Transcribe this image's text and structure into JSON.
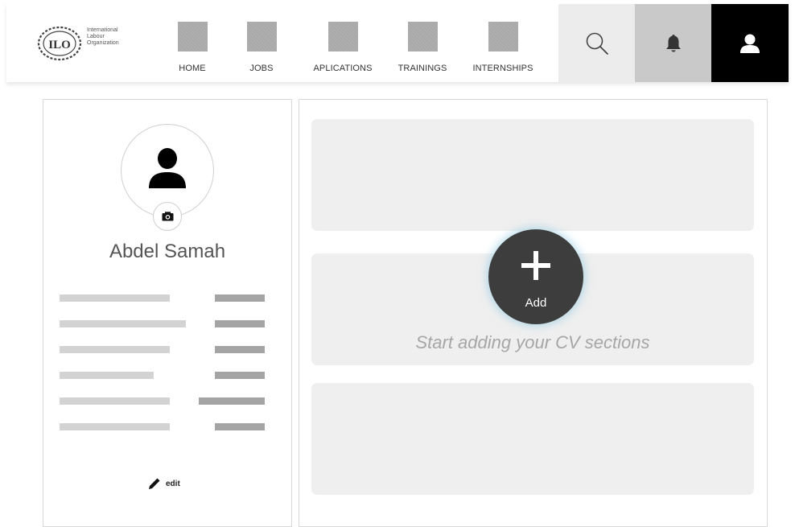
{
  "header": {
    "logo": {
      "name": "ILO",
      "lines": [
        "International",
        "Labour",
        "Organization"
      ]
    },
    "nav": [
      {
        "label": "HOME",
        "icon": "home-icon"
      },
      {
        "label": "JOBS",
        "icon": "jobs-icon"
      },
      {
        "label": "APLICATIONS",
        "icon": "applications-icon"
      },
      {
        "label": "TRAININGS",
        "icon": "trainings-icon"
      },
      {
        "label": "INTERNSHIPS",
        "icon": "internships-icon"
      }
    ],
    "actions": {
      "search": {
        "icon": "search-icon",
        "color": "#ececec"
      },
      "notifications": {
        "icon": "bell-icon",
        "color": "#c9c9c9"
      },
      "profile": {
        "icon": "user-icon",
        "color": "#000000"
      }
    }
  },
  "profile": {
    "name": "Abdel Samah",
    "avatar_icon": "person-icon",
    "camera_icon": "camera-icon",
    "edit_label": "edit",
    "edit_icon": "pencil-icon",
    "info_rows": 6
  },
  "cv": {
    "hint": "Start adding your CV sections",
    "add_label": "Add",
    "add_icon": "plus-icon",
    "sections": 3
  }
}
